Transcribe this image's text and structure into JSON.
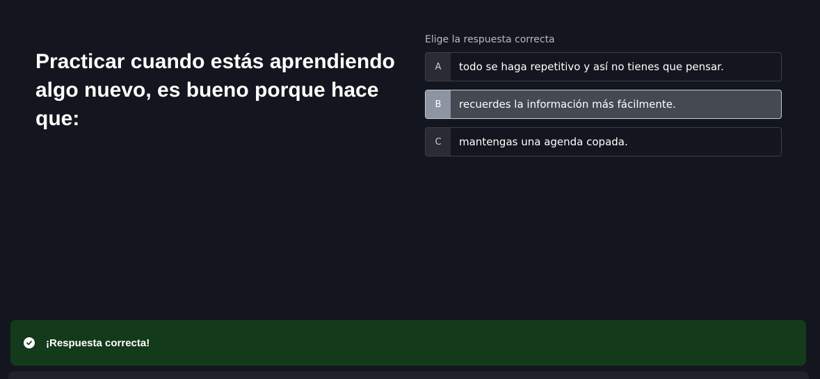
{
  "question": {
    "text": "Practicar cuando estás aprendiendo algo nuevo, es bueno porque hace que:"
  },
  "answers": {
    "instruction": "Elige la respuesta correcta",
    "options": [
      {
        "letter": "A",
        "text": "todo se haga repetitivo y así no tienes que pensar."
      },
      {
        "letter": "B",
        "text": "recuerdes la información más fácilmente."
      },
      {
        "letter": "C",
        "text": "mantengas una agenda copada."
      }
    ],
    "selected": "B"
  },
  "feedback": {
    "message": "¡Respuesta correcta!",
    "icon": "check-circle-icon",
    "color": "#133a1a"
  }
}
